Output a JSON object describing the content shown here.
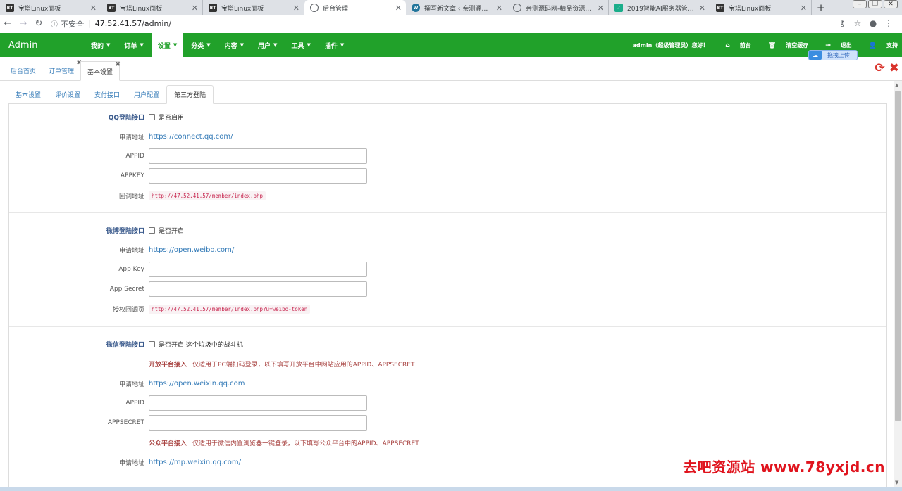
{
  "browser": {
    "tabs": [
      {
        "icon": "bt-icon",
        "title": "宝塔Linux面板",
        "active": false
      },
      {
        "icon": "bt-icon",
        "title": "宝塔Linux面板",
        "active": false
      },
      {
        "icon": "bt-icon",
        "title": "宝塔Linux面板",
        "active": false
      },
      {
        "icon": "globe-icon",
        "title": "后台管理",
        "active": true
      },
      {
        "icon": "wordpress-icon",
        "title": "撰写新文章 ‹ 亲测源码网 —",
        "active": false
      },
      {
        "icon": "globe-icon",
        "title": "亲测源码网-精品资源站长网",
        "active": false
      },
      {
        "icon": "check-icon",
        "title": "2019智能AI服务器管理系统",
        "active": false
      },
      {
        "icon": "bt-icon",
        "title": "宝塔Linux面板",
        "active": false
      }
    ],
    "fav_text": "BT",
    "new_tab": "+",
    "insecure_label": "不安全",
    "url": "47.52.41.57/admin/"
  },
  "navbar": {
    "brand": "Admin",
    "menu": [
      {
        "label": "我的",
        "active": false
      },
      {
        "label": "订单",
        "active": false
      },
      {
        "label": "设置",
        "active": true
      },
      {
        "label": "分类",
        "active": false
      },
      {
        "label": "内容",
        "active": false
      },
      {
        "label": "用户",
        "active": false
      },
      {
        "label": "工具",
        "active": false
      },
      {
        "label": "插件",
        "active": false
      }
    ],
    "greeting": "admin（超级管理员）您好！",
    "front": "前台",
    "clear_cache": "清空缓存",
    "logout": "退出",
    "support": "支持",
    "upload_bubble": "拖拽上传"
  },
  "page_tabs": [
    {
      "label": "后台首页",
      "active": false,
      "closable": false
    },
    {
      "label": "订单管理",
      "active": false,
      "closable": true
    },
    {
      "label": "基本设置",
      "active": true,
      "closable": true
    }
  ],
  "setting_tabs": [
    {
      "label": "基本设置",
      "active": false
    },
    {
      "label": "评价设置",
      "active": false
    },
    {
      "label": "支付接口",
      "active": false
    },
    {
      "label": "用户配置",
      "active": false
    },
    {
      "label": "第三方登陆",
      "active": true
    }
  ],
  "qq": {
    "title": "QQ登陆接口",
    "enable_label": "是否启用",
    "apply_label": "申请地址",
    "apply_url": "https://connect.qq.com/",
    "appid_label": "APPID",
    "appkey_label": "APPKEY",
    "callback_label": "回调地址",
    "callback_url": "http://47.52.41.57/member/index.php"
  },
  "weibo": {
    "title": "微博登陆接口",
    "enable_label": "是否开启",
    "apply_label": "申请地址",
    "apply_url": "https://open.weibo.com/",
    "appkey_label": "App Key",
    "secret_label": "App Secret",
    "callback_label": "授权回调页",
    "callback_url": "http://47.52.41.57/member/index.php?u=weibo-token"
  },
  "wechat": {
    "title": "微信登陆接口",
    "enable_label": "是否开启 这个垃圾中的战斗机",
    "open_platform": "开放平台接入",
    "open_note": "仅适用于PC端扫码登录，以下填写开放平台中网站应用的APPID、APPSECRET",
    "apply_label": "申请地址",
    "apply_url": "https://open.weixin.qq.com",
    "appid_label": "APPID",
    "secret_label": "APPSECRET",
    "mp_platform": "公众平台接入",
    "mp_note": "仅适用于微信内置浏览器一键登录，以下填写公众平台中的APPID、APPSECRET",
    "mp_apply_label": "申请地址",
    "mp_apply_url": "https://mp.weixin.qq.com/"
  },
  "watermark": "去吧资源站 www.78yxjd.cn"
}
